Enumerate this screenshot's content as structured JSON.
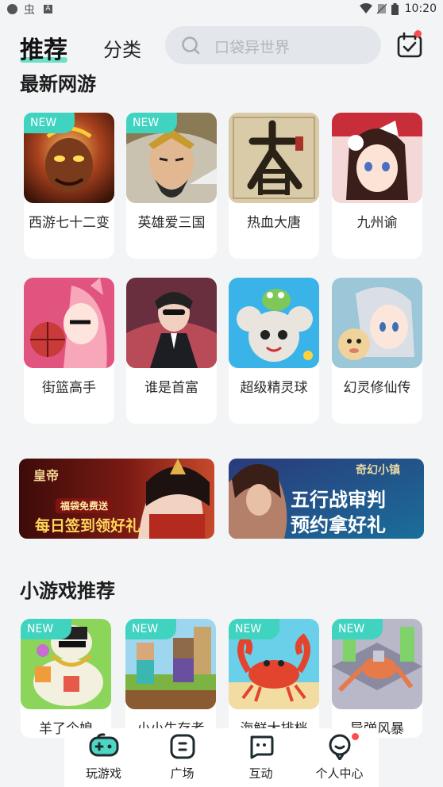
{
  "status_bar": {
    "time": "10:20"
  },
  "header": {
    "tab_recommend": "推荐",
    "tab_category": "分类",
    "search_placeholder": "口袋异世界"
  },
  "sections": {
    "new_games_title": "最新网游",
    "mini_games_title": "小游戏推荐"
  },
  "badge_label": "NEW",
  "new_games": [
    {
      "name": "西游七十二变",
      "badge": true
    },
    {
      "name": "英雄爱三国",
      "badge": true
    },
    {
      "name": "热血大唐",
      "badge": false
    },
    {
      "name": "九州谕",
      "badge": false
    },
    {
      "name": "街篮高手",
      "badge": false
    },
    {
      "name": "谁是首富",
      "badge": false
    },
    {
      "name": "超级精灵球",
      "badge": false
    },
    {
      "name": "幻灵修仙传",
      "badge": false
    }
  ],
  "banners": [
    {
      "text": "每日签到领好礼",
      "sub": "福袋免费送",
      "logo": "皇帝"
    },
    {
      "text": "五行战审判",
      "sub": "预约拿好礼",
      "logo": "奇幻小镇"
    }
  ],
  "mini_games": [
    {
      "name": "羊了个娘",
      "badge": true
    },
    {
      "name": "小小生存者",
      "badge": true
    },
    {
      "name": "海鲜大排档",
      "badge": true
    },
    {
      "name": "导弹风暴",
      "badge": true
    }
  ],
  "bottom_nav": [
    {
      "label": "玩游戏"
    },
    {
      "label": "广场"
    },
    {
      "label": "互动"
    },
    {
      "label": "个人中心"
    }
  ],
  "colors": {
    "accent": "#3fd3c0",
    "accent_underline": "#6ee0c8",
    "notification": "#ff4d4f",
    "background": "#f3f4f6"
  }
}
